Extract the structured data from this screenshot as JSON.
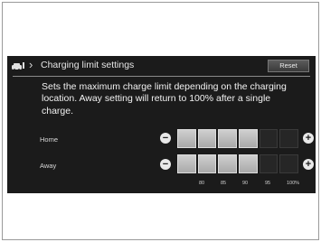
{
  "header": {
    "icon": "car-charge-icon",
    "chevron": "›",
    "title": "Charging limit settings",
    "reset_label": "Reset"
  },
  "description": "Sets the maximum charge limit depending on the charging location. Away setting will return to 100% after a single charge.",
  "rows": [
    {
      "label": "Home",
      "filled_segments": 4,
      "total_segments": 6
    },
    {
      "label": "Away",
      "filled_segments": 4,
      "total_segments": 6
    }
  ],
  "controls": {
    "minus": "−",
    "plus": "+"
  },
  "scale_labels": [
    "80",
    "85",
    "90",
    "95",
    "100%"
  ],
  "colors": {
    "screen_bg": "#1b1b1b",
    "segment_on": "#bdbdbd",
    "segment_off": "#262626"
  }
}
